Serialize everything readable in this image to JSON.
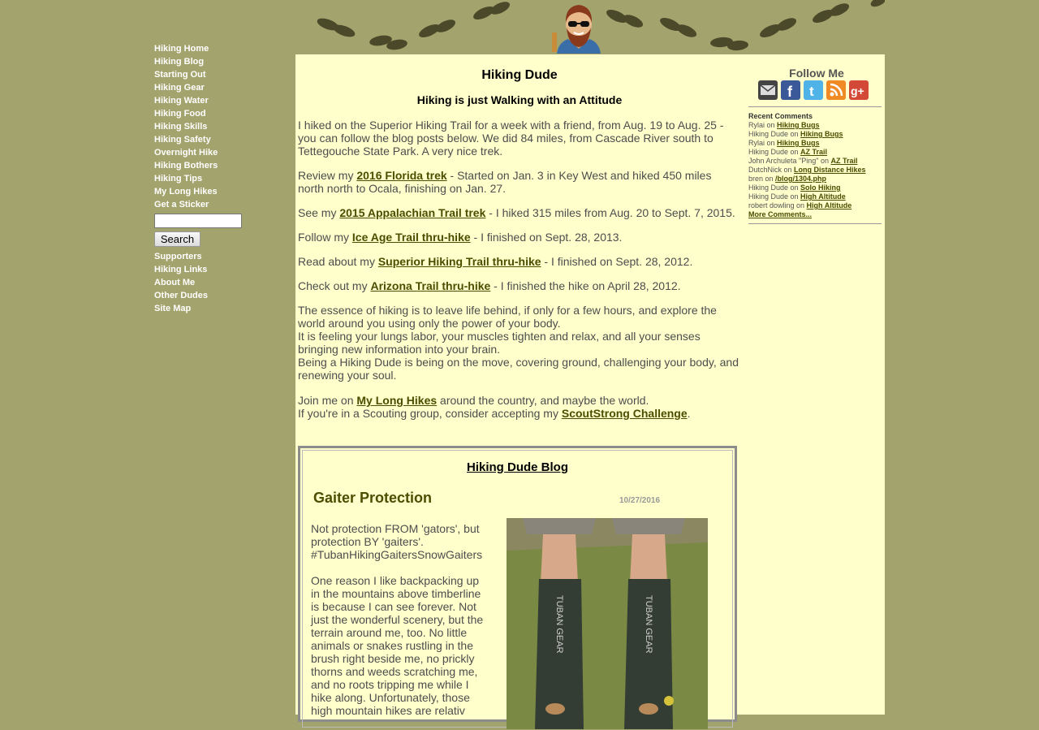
{
  "nav": {
    "items_top": [
      "Hiking Home",
      "Hiking Blog",
      "Starting Out",
      "Hiking Gear",
      "Hiking Water",
      "Hiking Food",
      "Hiking Skills",
      "Hiking Safety",
      "Overnight Hike",
      "Hiking Bothers",
      "Hiking Tips",
      "My Long Hikes",
      "Get a Sticker"
    ],
    "search_button": "Search",
    "search_value": "",
    "items_bottom": [
      "Supporters",
      "Hiking Links",
      "About Me",
      "Other Dudes",
      "Site Map"
    ]
  },
  "main": {
    "title": "Hiking Dude",
    "subtitle": "Hiking is just Walking with an Attitude",
    "p1": "I hiked on the Superior Hiking Trail for a week with a friend, from Aug. 19 to Aug. 25 - you can follow the blog posts below. We did 84 miles, from Cascade River south to Tettegouche State Park. A very nice trek.",
    "p2": {
      "pre": "Review my ",
      "link": "2016 Florida trek",
      "post": " - Started on Jan. 3 in Key West and hiked 450 miles north north to Ocala, finishing on Jan. 27."
    },
    "p3": {
      "pre": "See my ",
      "link": "2015 Appalachian Trail trek",
      "post": " - I hiked 315 miles from Aug. 20 to Sept. 7, 2015."
    },
    "p4": {
      "pre": "Follow my ",
      "link": "Ice Age Trail thru-hike",
      "post": " - I finished on Sept. 28, 2013."
    },
    "p5": {
      "pre": "Read about my ",
      "link": "Superior Hiking Trail thru-hike",
      "post": " - I finished on Sept. 28, 2012."
    },
    "p6": {
      "pre": "Check out my ",
      "link": "Arizona Trail thru-hike",
      "post": " - I finished the hike on April 28, 2012."
    },
    "essence1": "The essence of hiking is to leave life behind, if only for a few hours, and explore the world around you using only the power of your body.",
    "essence2": "It is feeling your lungs labor, your muscles tighten and relax, and all your senses bringing new information into your brain.",
    "essence3": "Being a Hiking Dude is being on the move, covering ground, challenging your body, and renewing your soul.",
    "join": {
      "pre": "Join me on ",
      "link": "My Long Hikes",
      "post": " around the country, and maybe the world."
    },
    "scout": {
      "pre": "If you're in a Scouting group, consider accepting my ",
      "link": "ScoutStrong Challenge",
      "post": "."
    }
  },
  "blog": {
    "title": "Hiking Dude Blog",
    "post_title": "Gaiter Protection",
    "post_date": "10/27/2016",
    "para1": "Not protection FROM 'gators', but protection BY 'gaiters'. #TubanHikingGaitersSnowGaiters",
    "para2": "One reason I like backpacking up in the mountains above timberline is because I can see forever. Not just the wonderful scenery, but the terrain around me, too. No little animals or snakes rustling in the brush right beside me, no prickly thorns and weeds scratching me, and no roots tripping me while I hike along. Unfortunately, those high mountain hikes are relativ",
    "gaiter_text": "TUBAN GEAR"
  },
  "sidebar": {
    "follow_title": "Follow Me",
    "social_icons": [
      "email-icon",
      "facebook-icon",
      "twitter-icon",
      "rss-icon",
      "google-plus-icon"
    ],
    "recent_title": "Recent Comments",
    "comments": [
      {
        "who": "Rylai",
        "on": " on ",
        "link": "Hiking Bugs"
      },
      {
        "who": "Hiking Dude",
        "on": " on ",
        "link": "Hiking Bugs"
      },
      {
        "who": "Rylai",
        "on": " on ",
        "link": "Hiking Bugs"
      },
      {
        "who": "Hiking Dude",
        "on": " on ",
        "link": "AZ Trail"
      },
      {
        "who": "John Archuleta \"Ping\"",
        "on": " on ",
        "link": "AZ Trail"
      },
      {
        "who": "DutchNick",
        "on": " on ",
        "link": "Long Distance Hikes"
      },
      {
        "who": "bren",
        "on": " on ",
        "link": "/blog/1304.php"
      },
      {
        "who": "Hiking Dude",
        "on": " on ",
        "link": "Solo Hiking"
      },
      {
        "who": "Hiking Dude",
        "on": " on ",
        "link": "High Altitude"
      },
      {
        "who": "robert dowling",
        "on": " on ",
        "link": "High Altitude"
      }
    ],
    "more": "More Comments..."
  },
  "colors": {
    "bg": "#a3a36e",
    "content": "#ffffcc",
    "link": "#4d4d00"
  }
}
